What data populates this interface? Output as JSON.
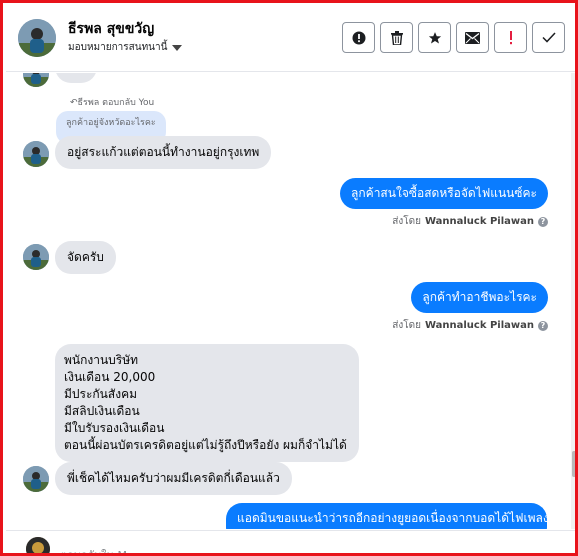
{
  "header": {
    "contact_name": "ธีรพล สุขขวัญ",
    "assign_label": "มอบหมายการสนทนานี้",
    "actions": [
      {
        "icon": "alert-circle-icon",
        "name": "mark-spam-button"
      },
      {
        "icon": "trash-icon",
        "name": "delete-button"
      },
      {
        "icon": "star-icon",
        "name": "star-button"
      },
      {
        "icon": "envelope-icon",
        "name": "mark-unread-button"
      },
      {
        "icon": "exclamation-icon",
        "name": "follow-up-button"
      },
      {
        "icon": "check-icon",
        "name": "mark-done-button"
      }
    ]
  },
  "colors": {
    "outgoing_bubble": "#0a7cff",
    "incoming_bubble": "#e4e6eb",
    "quoted_bubble": "#dbe7fb",
    "frame_border": "#e8131b",
    "follow_up_red": "#e41e3f"
  },
  "messages": {
    "reply_note": "↶ธีรพล ตอบกลับ You",
    "quoted_text": "ลูกค้าอยู่จังหวัดอะไรคะ",
    "msg1": "อยู่สระแก้วแต่ตอนนี้ทำงานอยู่กรุงเทพ",
    "out1": "ลูกค้าสนใจซื้อสดหรือจัดไฟแนนซ์คะ",
    "sent_by_label": "ส่งโดย",
    "sent_by_name": "Wannaluck Pilawan",
    "msg2": "จัดครับ",
    "out2": "ลูกค้าทำอาชีพอะไรคะ",
    "msg3_lines": [
      "พนักงานบริษัท",
      "เงินเดือน 20,000",
      "มีประกันสังคม",
      "มีสลิปเงินเดือน",
      "มีใบรับรองเงินเดือน",
      "ตอนนี้ผ่อนบัตรเครดิตอยู่แต่ไม่รู้ถึงปีหรือยัง ผมก็จำไม่ได้"
    ],
    "msg4": "พี่เช็คได้ไหมครับว่าผมมีเครดิตกี่เดือนแล้ว",
    "out3_partial": "แอดมินขอแนะนำว่ารถอีกอย่างยูยอดเนื่องจากบอดได้ไฟเพลง"
  },
  "composer": {
    "placeholder": "ตอบกลับใน Messenger..."
  }
}
